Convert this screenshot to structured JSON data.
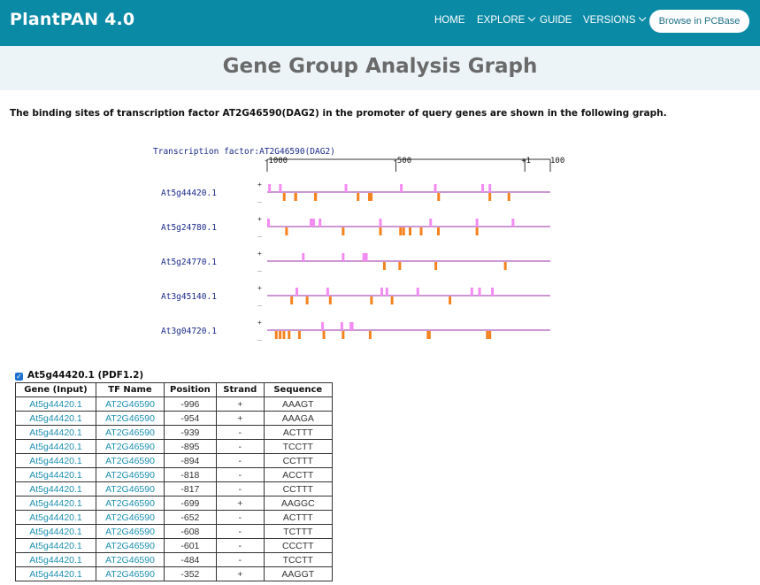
{
  "nav": {
    "brand": "PlantPAN 4.0",
    "items": [
      "HOME",
      "EXPLORE",
      "GUIDE",
      "VERSIONS"
    ],
    "cta": "Browse in PCBase"
  },
  "page": {
    "title": "Gene Group Analysis Graph",
    "intro": "The binding sites of transcription factor AT2G46590(DAG2) in the promoter of query genes are shown in the following graph."
  },
  "graph": {
    "tf_label": "Transcription factor:AT2G46590(DAG2)",
    "ticks": [
      "-1000",
      "-500",
      "+1",
      "100"
    ],
    "tick_positions": [
      -1000,
      -500,
      1,
      100
    ],
    "plus_label": "+",
    "minus_label": "_",
    "colors": {
      "plus": "#f28cf2",
      "minus": "#f4821f",
      "line": "#9b2fa8",
      "label": "#1a2a8a"
    },
    "genes": [
      {
        "id": "At5g44420.1",
        "plus": [
          -996,
          -954,
          -699,
          -484,
          -352,
          -168,
          -140
        ],
        "minus": [
          -939,
          -895,
          -894,
          -818,
          -817,
          -652,
          -608,
          -601,
          -339,
          -140,
          -66
        ]
      },
      {
        "id": "At5g24780.1",
        "plus": [
          -1000,
          -835,
          -825,
          -800,
          -565,
          -370,
          -190,
          -50
        ],
        "minus": [
          -930,
          -710,
          -565,
          -487,
          -475,
          -450,
          -407,
          -340,
          -190
        ]
      },
      {
        "id": "At5g24770.1",
        "plus": [
          -865,
          -710,
          -630,
          -620
        ],
        "minus": [
          -550,
          -490,
          -350,
          -80
        ]
      },
      {
        "id": "At3g45140.1",
        "plus": [
          -890,
          -770,
          -560,
          -540,
          -420,
          -210,
          -180,
          -130
        ],
        "minus": [
          -910,
          -850,
          -760,
          -600,
          -520,
          -295
        ]
      },
      {
        "id": "At3g04720.1",
        "plus": [
          -790,
          -715,
          -680,
          -675
        ],
        "minus": [
          -970,
          -955,
          -940,
          -920,
          -880,
          -785,
          -710,
          -605,
          -380,
          -375,
          -150,
          -140
        ]
      }
    ]
  },
  "table": {
    "gene_header": "At5g44420.1 (PDF1.2)",
    "columns": [
      "Gene (Input)",
      "TF Name",
      "Position",
      "Strand",
      "Sequence"
    ],
    "rows": [
      [
        "At5g44420.1",
        "AT2G46590",
        "-996",
        "+",
        "AAAGT"
      ],
      [
        "At5g44420.1",
        "AT2G46590",
        "-954",
        "+",
        "AAAGA"
      ],
      [
        "At5g44420.1",
        "AT2G46590",
        "-939",
        "-",
        "ACTTT"
      ],
      [
        "At5g44420.1",
        "AT2G46590",
        "-895",
        "-",
        "TCCTT"
      ],
      [
        "At5g44420.1",
        "AT2G46590",
        "-894",
        "-",
        "CCTTT"
      ],
      [
        "At5g44420.1",
        "AT2G46590",
        "-818",
        "-",
        "ACCTT"
      ],
      [
        "At5g44420.1",
        "AT2G46590",
        "-817",
        "-",
        "CCTTT"
      ],
      [
        "At5g44420.1",
        "AT2G46590",
        "-699",
        "+",
        "AAGGC"
      ],
      [
        "At5g44420.1",
        "AT2G46590",
        "-652",
        "-",
        "ACTTT"
      ],
      [
        "At5g44420.1",
        "AT2G46590",
        "-608",
        "-",
        "TCTTT"
      ],
      [
        "At5g44420.1",
        "AT2G46590",
        "-601",
        "-",
        "CCCTT"
      ],
      [
        "At5g44420.1",
        "AT2G46590",
        "-484",
        "-",
        "TCCTT"
      ],
      [
        "At5g44420.1",
        "AT2G46590",
        "-352",
        "+",
        "AAGGT"
      ]
    ]
  }
}
